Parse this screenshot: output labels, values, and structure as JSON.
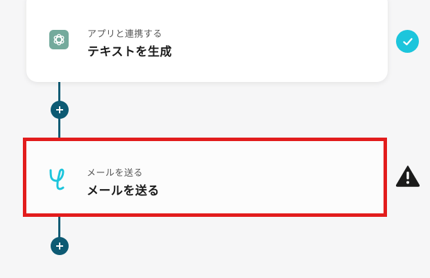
{
  "steps": [
    {
      "subtitle": "アプリと連携する",
      "title": "テキストを生成",
      "icon": "chatgpt-icon",
      "status": "complete"
    },
    {
      "subtitle": "メールを送る",
      "title": "メールを送る",
      "icon": "yoom-mail-icon",
      "status": "warning",
      "highlighted": true
    }
  ],
  "colors": {
    "connector": "#0d5a73",
    "check": "#1cc5dc",
    "highlight": "#e21c1c",
    "warning": "#1b1b1b",
    "chatgpt_bg": "#74aa9c",
    "mail_icon": "#1cc5dc"
  }
}
